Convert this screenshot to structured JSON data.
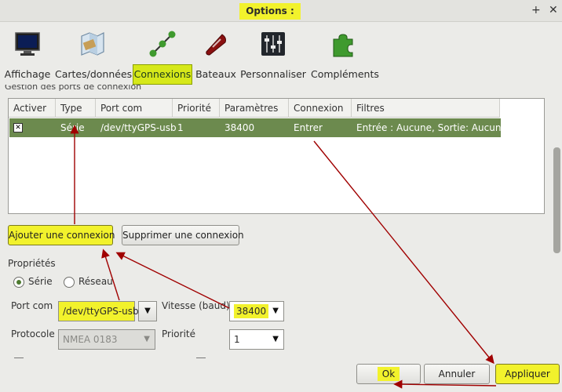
{
  "window": {
    "title": "Options :",
    "plus_glyph": "+",
    "close_glyph": "✕"
  },
  "toolbar": {
    "items": [
      {
        "label": "Affichage",
        "icon": "monitor-icon"
      },
      {
        "label": "Cartes/données",
        "icon": "chart-map-icon"
      },
      {
        "label": "Connexions",
        "icon": "network-nodes-icon",
        "active": true
      },
      {
        "label": "Bateaux",
        "icon": "boat-icon"
      },
      {
        "label": "Personnaliser",
        "icon": "sliders-icon"
      },
      {
        "label": "Compléments",
        "icon": "puzzle-icon"
      }
    ]
  },
  "connections": {
    "group_label": "Gestion des ports de connexion",
    "columns": [
      "Activer",
      "Type",
      "Port com",
      "Priorité",
      "Paramètres",
      "Connexion",
      "Filtres"
    ],
    "rows": [
      {
        "enabled_glyph": "✕",
        "type": "Série",
        "port": "/dev/ttyGPS-usb",
        "priority": "1",
        "params": "38400",
        "connection": "Entrer",
        "filters": "Entrée : Aucune, Sortie: Aucune"
      }
    ],
    "add_label": "Ajouter une connexion",
    "remove_label": "Supprimer une connexion"
  },
  "properties": {
    "title": "Propriétés",
    "radio_serial": "Série",
    "radio_network": "Réseau",
    "port_label": "Port com",
    "port_value": "/dev/ttyGPS-usb",
    "speed_label": "Vitesse (baud)",
    "speed_value": "38400",
    "protocol_label": "Protocole",
    "protocol_value": "NMEA 0183",
    "priority_label": "Priorité",
    "priority_value": "1",
    "dropdown_glyph": "▼"
  },
  "footer": {
    "ok": "Ok",
    "cancel": "Annuler",
    "apply": "Appliquer"
  },
  "colors": {
    "highlight": "#f2f22c",
    "selected_row": "#6c8a4e",
    "annotation_arrow": "#a00000"
  }
}
